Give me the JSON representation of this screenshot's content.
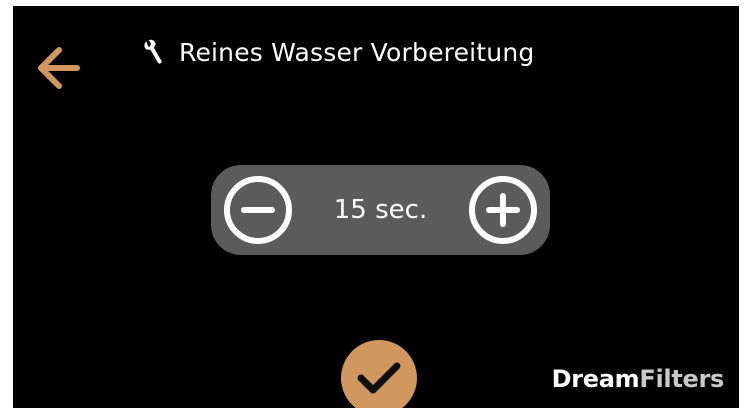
{
  "header": {
    "title": "Reines Wasser Vorbereitung",
    "back_icon": "arrow-left-icon",
    "title_icon": "wrench-icon"
  },
  "stepper": {
    "value": "15 sec.",
    "decrement_icon": "minus-circle-icon",
    "increment_icon": "plus-circle-icon"
  },
  "confirm": {
    "icon": "checkmark-icon"
  },
  "brand": {
    "part1": "Dream",
    "part2": "Filters"
  },
  "colors": {
    "background": "#000000",
    "accent": "#d1975f",
    "stepper_background": "#5b5b5b",
    "text": "#ffffff"
  }
}
